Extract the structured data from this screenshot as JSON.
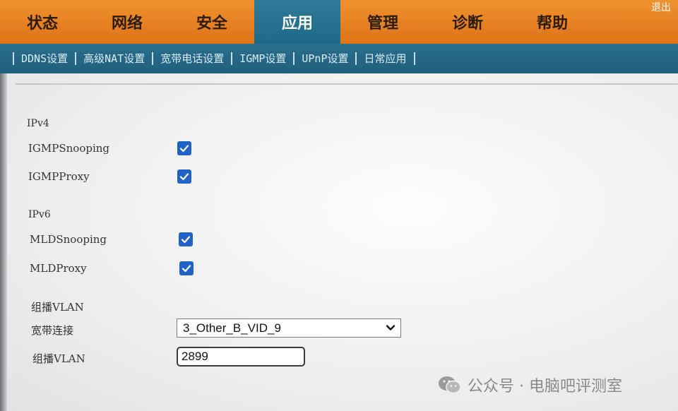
{
  "top_nav": {
    "tabs": [
      {
        "label": "状态",
        "active": false
      },
      {
        "label": "网络",
        "active": false
      },
      {
        "label": "安全",
        "active": false
      },
      {
        "label": "应用",
        "active": true
      },
      {
        "label": "管理",
        "active": false
      },
      {
        "label": "诊断",
        "active": false
      },
      {
        "label": "帮助",
        "active": false
      }
    ],
    "corner_text": "退出",
    "colors": {
      "bar": "#e8821f",
      "active": "#2a7593"
    }
  },
  "sub_nav": {
    "items": [
      "DDNS设置",
      "高级NAT设置",
      "宽带电话设置",
      "IGMP设置",
      "UPnP设置",
      "日常应用"
    ],
    "active": "IGMP设置",
    "color": "#246784"
  },
  "form": {
    "ipv4": {
      "title": "IPv4",
      "igmp_snooping": {
        "label": "IGMPSnooping",
        "checked": true
      },
      "igmp_proxy": {
        "label": "IGMPProxy",
        "checked": true
      }
    },
    "ipv6": {
      "title": "IPv6",
      "mld_snooping": {
        "label": "MLDSnooping",
        "checked": true
      },
      "mld_proxy": {
        "label": "MLDProxy",
        "checked": true
      }
    },
    "multicast_vlan": {
      "title": "组播VLAN",
      "wan_label": "宽带连接",
      "wan_value": "3_Other_B_VID_9",
      "vlan_label": "组播VLAN",
      "vlan_value": "2899"
    },
    "checkbox_color": "#1f63c9"
  },
  "watermark": {
    "text": "公众号 · 电脑吧评测室",
    "icon": "wechat-icon"
  }
}
